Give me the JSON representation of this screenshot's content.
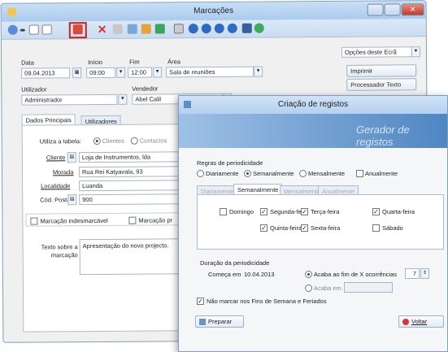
{
  "main_window": {
    "title": "Marcações",
    "options": {
      "select_value": "Opções deste Ecrã",
      "print_label": "Imprimir",
      "text_processor_label": "Processador Texto"
    },
    "fields": {
      "data_label": "Data",
      "data_value": "09.04.2013",
      "inicio_label": "Início",
      "inicio_value": "09:00",
      "fim_label": "Fim",
      "fim_value": "12:00",
      "area_label": "Área",
      "area_value": "Sala de reuniões",
      "utilizador_label": "Utilizador",
      "utilizador_value": "Administrador",
      "vendedor_label": "Vendedor",
      "vendedor_value": "Abel Calil"
    },
    "tabs": [
      "Dados Principais",
      "Utilizadores"
    ],
    "utiliza": {
      "label": "Utiliza a tabela:",
      "opt1": "Clientes",
      "opt2": "Contactos"
    },
    "cliente": {
      "label": "Cliente",
      "value": "Loja de Instrumentos, lda"
    },
    "morada": {
      "label": "Morada",
      "value": "Rua Rei Katyavala, 93"
    },
    "localidade": {
      "label": "Localidade",
      "value": "Luanda"
    },
    "cod_postal": {
      "label": "Cód. Postal",
      "value": "900"
    },
    "check1": "Marcação indesmarcável",
    "check2": "Marcação pr",
    "texto": {
      "label": "Texto sobre a marcação",
      "value": "Apresentação do novo projecto."
    }
  },
  "dialog": {
    "title": "Criação de registos",
    "banner_text": "Gerador de registos",
    "regras_label": "Regras de periodicidade",
    "period_options": [
      "Diariamente",
      "Semanalmente",
      "Mensalmente",
      "Anualmente"
    ],
    "tabs": [
      "Diariamente",
      "Semanalmente",
      "Mensalmente",
      "Anualmente"
    ],
    "days": [
      {
        "label": "Domingo",
        "checked": false
      },
      {
        "label": "Segunda-feira",
        "checked": true
      },
      {
        "label": "Terça-feira",
        "checked": true
      },
      {
        "label": "Quarta-feira",
        "checked": true
      },
      {
        "label": "Quinta-feira",
        "checked": true
      },
      {
        "label": "Sexta-feira",
        "checked": true
      },
      {
        "label": "Sábado",
        "checked": false
      }
    ],
    "duracao_label": "Duração da periodicidade",
    "comeca_label": "Começa em",
    "comeca_value": "10.04.2013",
    "acaba_x_label": "Acaba ao fim de X ocorrências",
    "acaba_x_value": "7",
    "acaba_em_label": "Acaba em",
    "nao_marcar_label": "Não marcar nos Fins de Semana e Feriados",
    "preparar_label": "Preparar",
    "voltar_label": "Voltar"
  },
  "colors": {
    "accent": "#1a4f9c",
    "highlight_box": "#cc1f1f",
    "title_bar": "#b8d3ef",
    "banner": "#5d8fc4"
  }
}
